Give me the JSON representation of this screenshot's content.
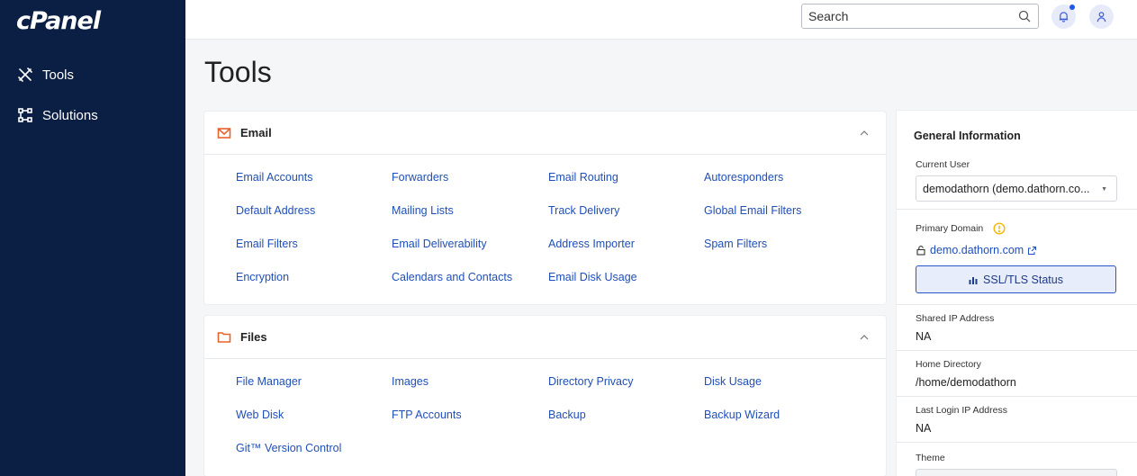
{
  "brand": {
    "logo_text": "cPanel"
  },
  "sidebar": {
    "items": [
      {
        "label": "Tools",
        "icon": "tools-icon"
      },
      {
        "label": "Solutions",
        "icon": "solutions-icon"
      }
    ]
  },
  "topbar": {
    "search_placeholder": "Search",
    "icons": [
      "search-icon",
      "bell-icon",
      "user-icon"
    ]
  },
  "page": {
    "title": "Tools"
  },
  "email_section": {
    "title": "Email",
    "icon": "envelope-icon",
    "accent_color": "#e8622c",
    "links": [
      "Email Accounts",
      "Forwarders",
      "Email Routing",
      "Autoresponders",
      "Default Address",
      "Mailing Lists",
      "Track Delivery",
      "Global Email Filters",
      "Email Filters",
      "Email Deliverability",
      "Address Importer",
      "Spam Filters",
      "Encryption",
      "Calendars and Contacts",
      "Email Disk Usage"
    ]
  },
  "files_section": {
    "title": "Files",
    "icon": "folder-icon",
    "links": [
      "File Manager",
      "Images",
      "Directory Privacy",
      "Disk Usage",
      "Web Disk",
      "FTP Accounts",
      "Backup",
      "Backup Wizard",
      "Git™ Version Control"
    ]
  },
  "general_info": {
    "title": "General Information",
    "current_user_label": "Current User",
    "current_user_value": "demodathorn (demo.dathorn.co...",
    "primary_domain_label": "Primary Domain",
    "primary_domain_value": "demo.dathorn.com",
    "ssl_button": "SSL/TLS Status",
    "shared_ip_label": "Shared IP Address",
    "shared_ip_value": "NA",
    "home_dir_label": "Home Directory",
    "home_dir_value": "/home/demodathorn",
    "last_login_label": "Last Login IP Address",
    "last_login_value": "NA",
    "theme_label": "Theme"
  },
  "colors": {
    "sidebar_bg": "#0b1f44",
    "link": "#1f4fb8",
    "accent": "#e8622c",
    "warning": "#f2b705"
  }
}
